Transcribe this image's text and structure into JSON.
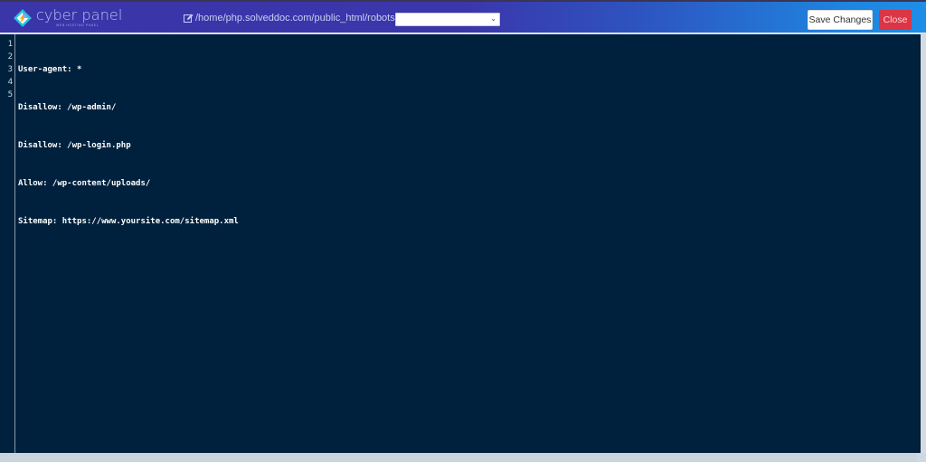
{
  "header": {
    "logo_text": "cyber panel",
    "logo_tagline": "WEB HOSTING PANEL",
    "file_path": "/home/php.solveddoc.com/public_html/robots.txt",
    "file_icon": "edit-icon",
    "theme_select": {
      "selected": ""
    },
    "save_label": "Save Changes",
    "close_label": "Close"
  },
  "colors": {
    "header_gradient_start": "#3a35a9",
    "header_gradient_end": "#1e8ee6",
    "editor_bg": "#00213d",
    "close_button": "#dc3545"
  },
  "editor": {
    "line_numbers": [
      "1",
      "2",
      "3",
      "4",
      "5"
    ],
    "lines": [
      "User-agent: *",
      "Disallow: /wp-admin/",
      "Disallow: /wp-login.php",
      "Allow: /wp-content/uploads/",
      "Sitemap: https://www.yoursite.com/sitemap.xml"
    ]
  }
}
